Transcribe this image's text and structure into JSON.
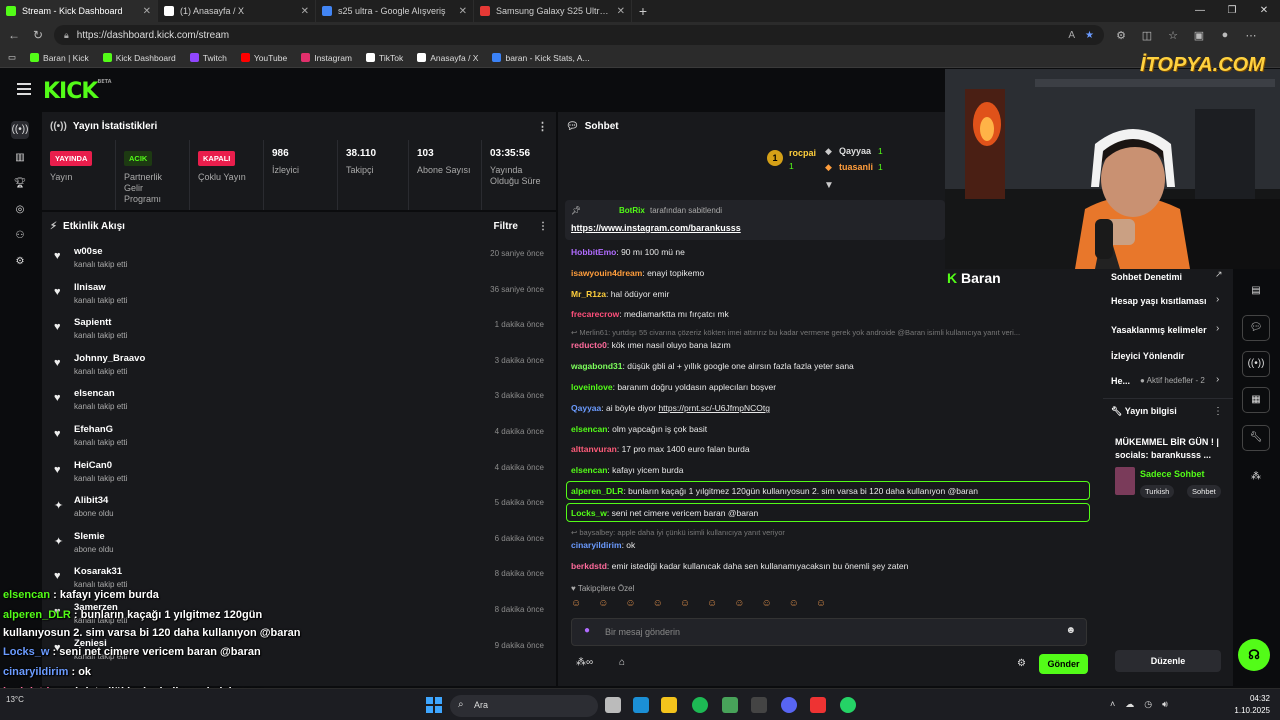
{
  "browser": {
    "tabs": [
      {
        "title": "Stream - Kick Dashboard",
        "color": "#53fc18",
        "active": true
      },
      {
        "title": "(1) Anasayfa / X",
        "color": "#ffffff",
        "active": false
      },
      {
        "title": "s25 ultra - Google Alışveriş",
        "color": "#4285f4",
        "active": false
      },
      {
        "title": "Samsung Galaxy S25 Ultra 512 GB",
        "color": "#e53935",
        "active": false
      }
    ],
    "url": "https://dashboard.kick.com/stream",
    "bookmarks": [
      {
        "label": "Baran | Kick",
        "color": "#53fc18"
      },
      {
        "label": "Kick Dashboard",
        "color": "#53fc18"
      },
      {
        "label": "Twitch",
        "color": "#9146ff"
      },
      {
        "label": "YouTube",
        "color": "#ff0000"
      },
      {
        "label": "Instagram",
        "color": "#e1306c"
      },
      {
        "label": "TikTok",
        "color": "#ffffff"
      },
      {
        "label": "Anasayfa / X",
        "color": "#ffffff"
      },
      {
        "label": "baran - Kick Stats, A...",
        "color": "#3b82f6"
      }
    ],
    "watermark": "İTOPYA.COM"
  },
  "kick": {
    "logo": "KICK",
    "logo_beta": "BETA",
    "stats_title": "Yayın İstatistikleri",
    "stats": [
      {
        "badge": "YAYINDA",
        "badge_color": "#e91e4c",
        "label": "Yayın"
      },
      {
        "badge": "ACIK",
        "badge_color": "#53fc18",
        "label": "Partnerlik Gelir Programı"
      },
      {
        "badge": "KAPALI",
        "badge_color": "#e91e4c",
        "label": "Çoklu Yayın"
      },
      {
        "value": "986",
        "label": "İzleyici"
      },
      {
        "value": "38.110",
        "label": "Takipçi"
      },
      {
        "value": "103",
        "label": "Abone Sayısı"
      },
      {
        "value": "03:35:56",
        "label": "Yayında Olduğu Süre"
      }
    ],
    "activity_title": "Etkinlik Akışı",
    "activity_filter": "Filtre",
    "activity": [
      {
        "name": "w00se",
        "sub": "kanalı takip etti",
        "time": "20 saniye önce",
        "icon": "heart"
      },
      {
        "name": "llnisaw",
        "sub": "kanalı takip etti",
        "time": "36 saniye önce",
        "icon": "heart"
      },
      {
        "name": "Sapientt",
        "sub": "kanalı takip etti",
        "time": "1 dakika önce",
        "icon": "heart"
      },
      {
        "name": "Johnny_Braavo",
        "sub": "kanalı takip etti",
        "time": "3 dakika önce",
        "icon": "heart"
      },
      {
        "name": "elsencan",
        "sub": "kanalı takip etti",
        "time": "3 dakika önce",
        "icon": "heart"
      },
      {
        "name": "EfehanG",
        "sub": "kanalı takip etti",
        "time": "4 dakika önce",
        "icon": "heart"
      },
      {
        "name": "HeiCan0",
        "sub": "kanalı takip etti",
        "time": "4 dakika önce",
        "icon": "heart"
      },
      {
        "name": "Alibit34",
        "sub": "abone oldu",
        "time": "5 dakika önce",
        "icon": "sparkle"
      },
      {
        "name": "Slemie",
        "sub": "abone oldu",
        "time": "6 dakika önce",
        "icon": "sparkle"
      },
      {
        "name": "Kosarak31",
        "sub": "kanalı takip etti",
        "time": "8 dakika önce",
        "icon": "heart"
      },
      {
        "name": "3amerzen",
        "sub": "kanalı takip etti",
        "time": "8 dakika önce",
        "icon": "heart"
      },
      {
        "name": "Zeniesi",
        "sub": "kanalı takip etti",
        "time": "9 dakika önce",
        "icon": "heart"
      }
    ],
    "chat_title": "Sohbet",
    "top_gifters": [
      {
        "rank": "1",
        "name": "rocpai",
        "count": "1"
      },
      {
        "name": "Qayyaa",
        "count": "1"
      },
      {
        "name": "tuasanli",
        "count": "1"
      }
    ],
    "pinned": {
      "by": "BotRix",
      "by_suffix": "tarafından sabitlendi",
      "link": "https://www.instagram.com/barankusss"
    },
    "messages": [
      {
        "user": "HobbitEmo",
        "color": "#b06bff",
        "text": "90 mı 100 mü ne"
      },
      {
        "user": "isawyouin4dream",
        "color": "#ff9d3c",
        "text": "enayi topikemo"
      },
      {
        "user": "Mr_R1za",
        "color": "#ffcf3c",
        "text": "hal ödüyor emir"
      },
      {
        "user": "frecarecrow",
        "color": "#ff4f7b",
        "text": "mediamarktta mı fırçatcı mk"
      },
      {
        "reply": "Merlin61: yurtdışı 55 civarına çözeriz kökten imei attırırız bu kadar vermene gerek yok androide @Baran isimli kullanıcıya yanıt veri..."
      },
      {
        "user": "reducto0",
        "color": "#ff6b9c",
        "text": "kök ımeı nasıl oluyo bana lazım"
      },
      {
        "user": "wagabond31",
        "color": "#7dff5c",
        "text": "düşük gbli al + yıllık google one alırsın fazla fazla yeter sana"
      },
      {
        "user": "loveinlove",
        "color": "#53fc18",
        "text": "baranım doğru yoldasın applecıları boşver"
      },
      {
        "user": "Qayyaa",
        "color": "#6b9bff",
        "text": "ai böyle diyor",
        "link": "https://prnt.sc/-U6JfmpNCOtg"
      },
      {
        "user": "elsencan",
        "color": "#53fc18",
        "text": "olm yapcağın iş çok basit"
      },
      {
        "user": "alttanvuran",
        "color": "#ff5c7a",
        "text": "17 pro max 1400 euro falan burda"
      },
      {
        "user": "elsencan",
        "color": "#53fc18",
        "text": "kafayı yicem burda"
      },
      {
        "user": "alperen_DLR",
        "color": "#53fc18",
        "text": "bunların kaçağı 1 yılgitmez 120gün kullanıyosun 2. sim varsa bi 120 daha kullanıyon @baran",
        "highlight": true
      },
      {
        "user": "Locks_w",
        "color": "#53fc18",
        "text": "seni net cimere vericem baran @baran",
        "highlight": true
      },
      {
        "reply": "baysalbey: apple daha iyi çünkü isimli kullanıcıya yanıt veriyor"
      },
      {
        "user": "cinaryildirim",
        "color": "#6b9bff",
        "text": "ok"
      },
      {
        "user": "berkdstd",
        "color": "#ff6b9c",
        "text": "emir istediği kadar kullanıcak daha sen kullanamıyacaksın bu önemli şey zaten"
      }
    ],
    "followers_only": "Takipçilere Özel",
    "chat_placeholder": "Bir mesaj gönderin",
    "send_label": "Gönder",
    "channel_name": "Baran",
    "mod_panel": {
      "title": "Sohbet Denetimi",
      "items": [
        "Hesap yaşı kısıtlaması",
        "Yasaklanmış kelimeler",
        "İzleyici Yönlendir",
        "He...",
        "Aktif hedefler - 2"
      ]
    },
    "stream_info": {
      "title": "Yayın bilgisi",
      "stream_title": "MÜKEMMEL BİR GÜN ! | socials: barankusss ...",
      "category": "Sadece Sohbet",
      "tags": [
        "Turkish",
        "Sohbet"
      ],
      "edit_label": "Düzenle"
    }
  },
  "overlay": [
    {
      "user": "elsencan",
      "color": "#53fc18",
      "text": "kafayı yicem burda"
    },
    {
      "user": "alperen_DLR",
      "color": "#53fc18",
      "text": "bunların kaçağı 1 yılgitmez 120gün"
    },
    {
      "text": "kullanıyosun 2. sim varsa bi 120 daha kullanıyon @baran"
    },
    {
      "user": "Locks_w",
      "color": "#6b9bff",
      "text": "seni net cimere vericem baran @baran"
    },
    {
      "user": "cinaryildirim",
      "color": "#6b9bff",
      "text": "ok"
    },
    {
      "user": "berkdstd",
      "color": "#ff6b9c",
      "text": "emir istediği kadar kullanıcak daha sen"
    },
    {
      "text": "kullanamıyacaksın bu önemli şey zaten"
    }
  ],
  "taskbar": {
    "search": "Ara",
    "time": "04:32",
    "date": "1.10.2025",
    "weather": "13°C"
  }
}
